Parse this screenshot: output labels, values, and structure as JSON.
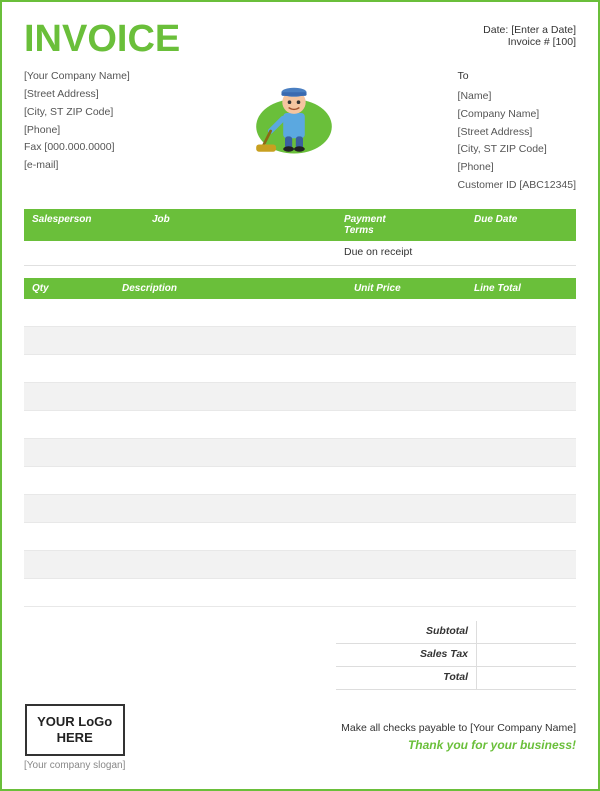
{
  "header": {
    "title": "INVOICE",
    "date_label": "Date:",
    "date_value": "[Enter a Date]",
    "invoice_label": "Invoice #",
    "invoice_number": "[100]"
  },
  "seller": {
    "company": "[Your Company Name]",
    "address": "[Street Address]",
    "city": "[City, ST  ZIP Code]",
    "phone": "[Phone]",
    "fax": "Fax [000.000.0000]",
    "email": "[e-mail]"
  },
  "to_label": "To",
  "buyer": {
    "name": "[Name]",
    "company": "[Company Name]",
    "address": "[Street Address]",
    "city": "[City, ST  ZIP Code]",
    "phone": "[Phone]",
    "customer_id": "Customer ID [ABC12345]"
  },
  "table1": {
    "headers": [
      "Salesperson",
      "Job",
      "Payment\nTerms",
      "Due Date"
    ],
    "rows": [
      [
        "",
        "",
        "Due on receipt",
        ""
      ]
    ]
  },
  "table2": {
    "headers": [
      "Qty",
      "Description",
      "Unit Price",
      "Line Total"
    ],
    "rows": [
      [
        "",
        "",
        "",
        ""
      ],
      [
        "",
        "",
        "",
        ""
      ],
      [
        "",
        "",
        "",
        ""
      ],
      [
        "",
        "",
        "",
        ""
      ],
      [
        "",
        "",
        "",
        ""
      ],
      [
        "",
        "",
        "",
        ""
      ],
      [
        "",
        "",
        "",
        ""
      ],
      [
        "",
        "",
        "",
        ""
      ],
      [
        "",
        "",
        "",
        ""
      ],
      [
        "",
        "",
        "",
        ""
      ],
      [
        "",
        "",
        "",
        ""
      ]
    ]
  },
  "totals": {
    "subtotal_label": "Subtotal",
    "tax_label": "Sales Tax",
    "total_label": "Total",
    "subtotal_value": "",
    "tax_value": "",
    "total_value": ""
  },
  "footer": {
    "logo_text": "YOUR LoGo HERE",
    "slogan": "[Your company slogan]",
    "payable": "Make all checks payable to [Your Company Name]",
    "thank_you": "Thank you for your business!"
  }
}
